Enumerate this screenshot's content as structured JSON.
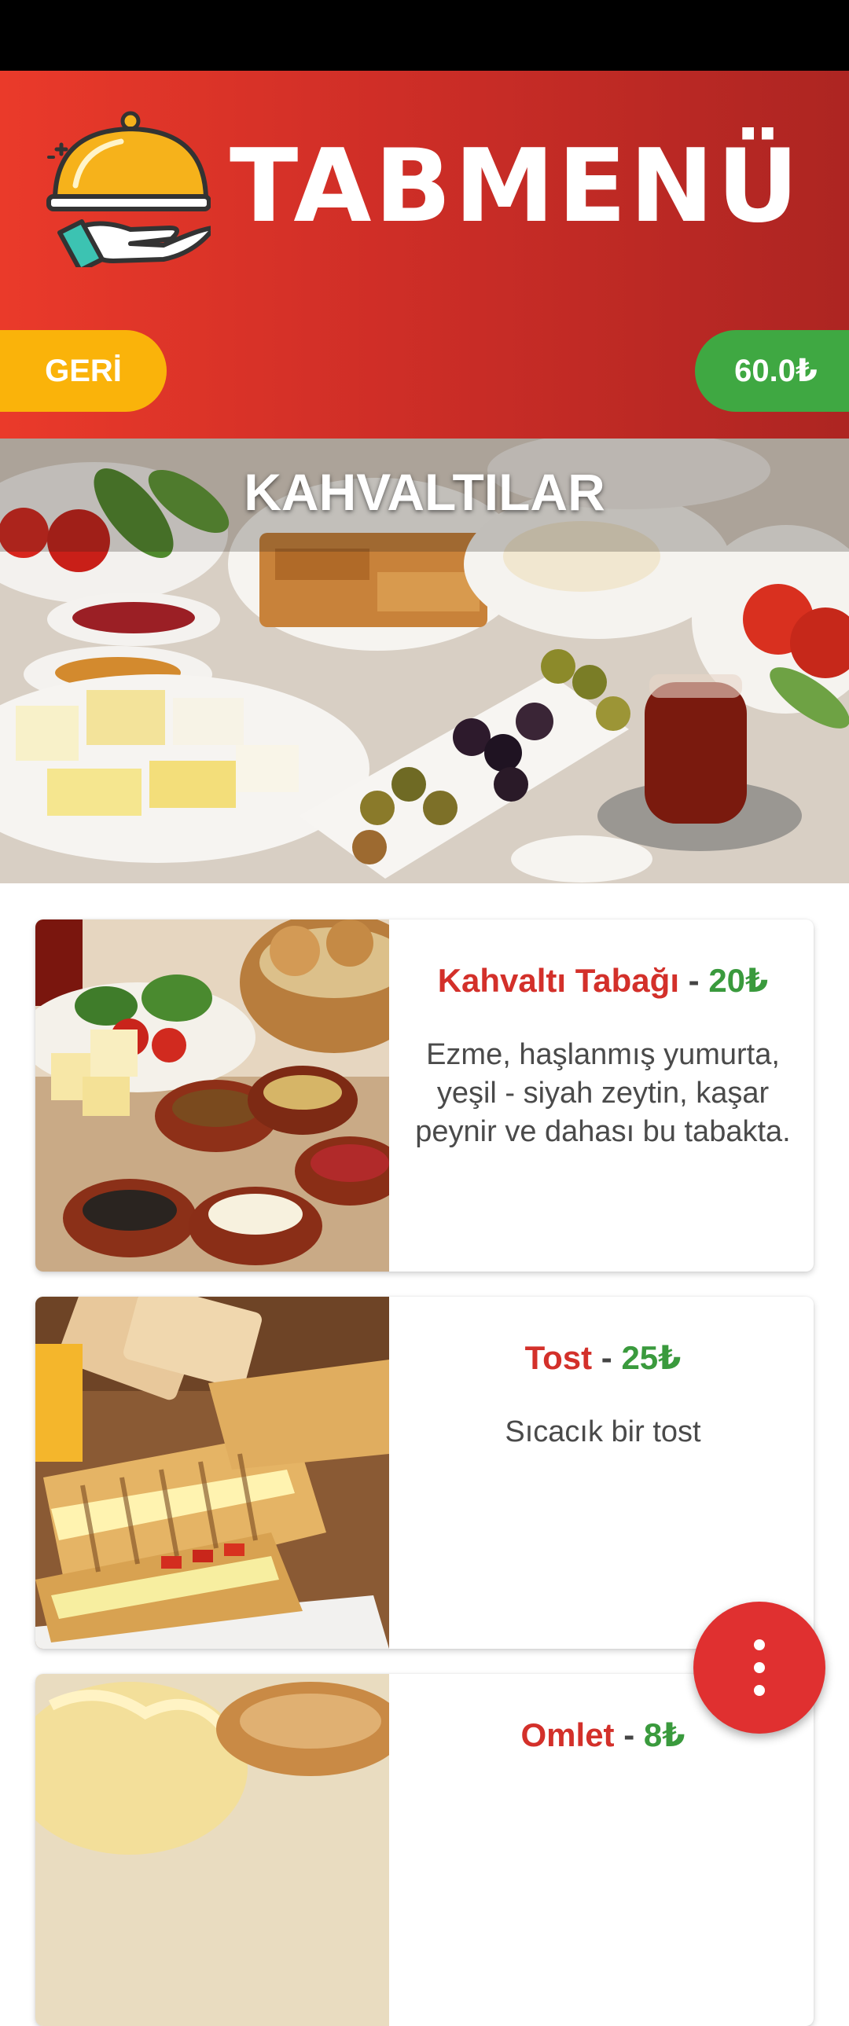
{
  "header": {
    "brand": "TABMENÜ",
    "back_label": "GERİ",
    "total": "60.0₺",
    "logo_icon": "serving-cloche-hand-icon"
  },
  "category": {
    "title": "KAHVALTILAR"
  },
  "products": [
    {
      "name": "Kahvaltı Tabağı",
      "separator": " - ",
      "price": "20₺",
      "description": "Ezme, haşlanmış yumurta, yeşil - siyah zeytin, kaşar peynir ve dahası bu tabakta."
    },
    {
      "name": "Tost",
      "separator": " - ",
      "price": "25₺",
      "description": "Sıcacık bir tost"
    },
    {
      "name": "Omlet",
      "separator": " - ",
      "price": "8₺",
      "description": ""
    }
  ],
  "fab": {
    "icon": "more-vertical-icon"
  },
  "colors": {
    "header_red": "#cf2e27",
    "back_yellow": "#fab30a",
    "total_green": "#3fa842",
    "name_red": "#d3302a",
    "price_green": "#3a9a3d",
    "fab_red": "#e03030"
  }
}
